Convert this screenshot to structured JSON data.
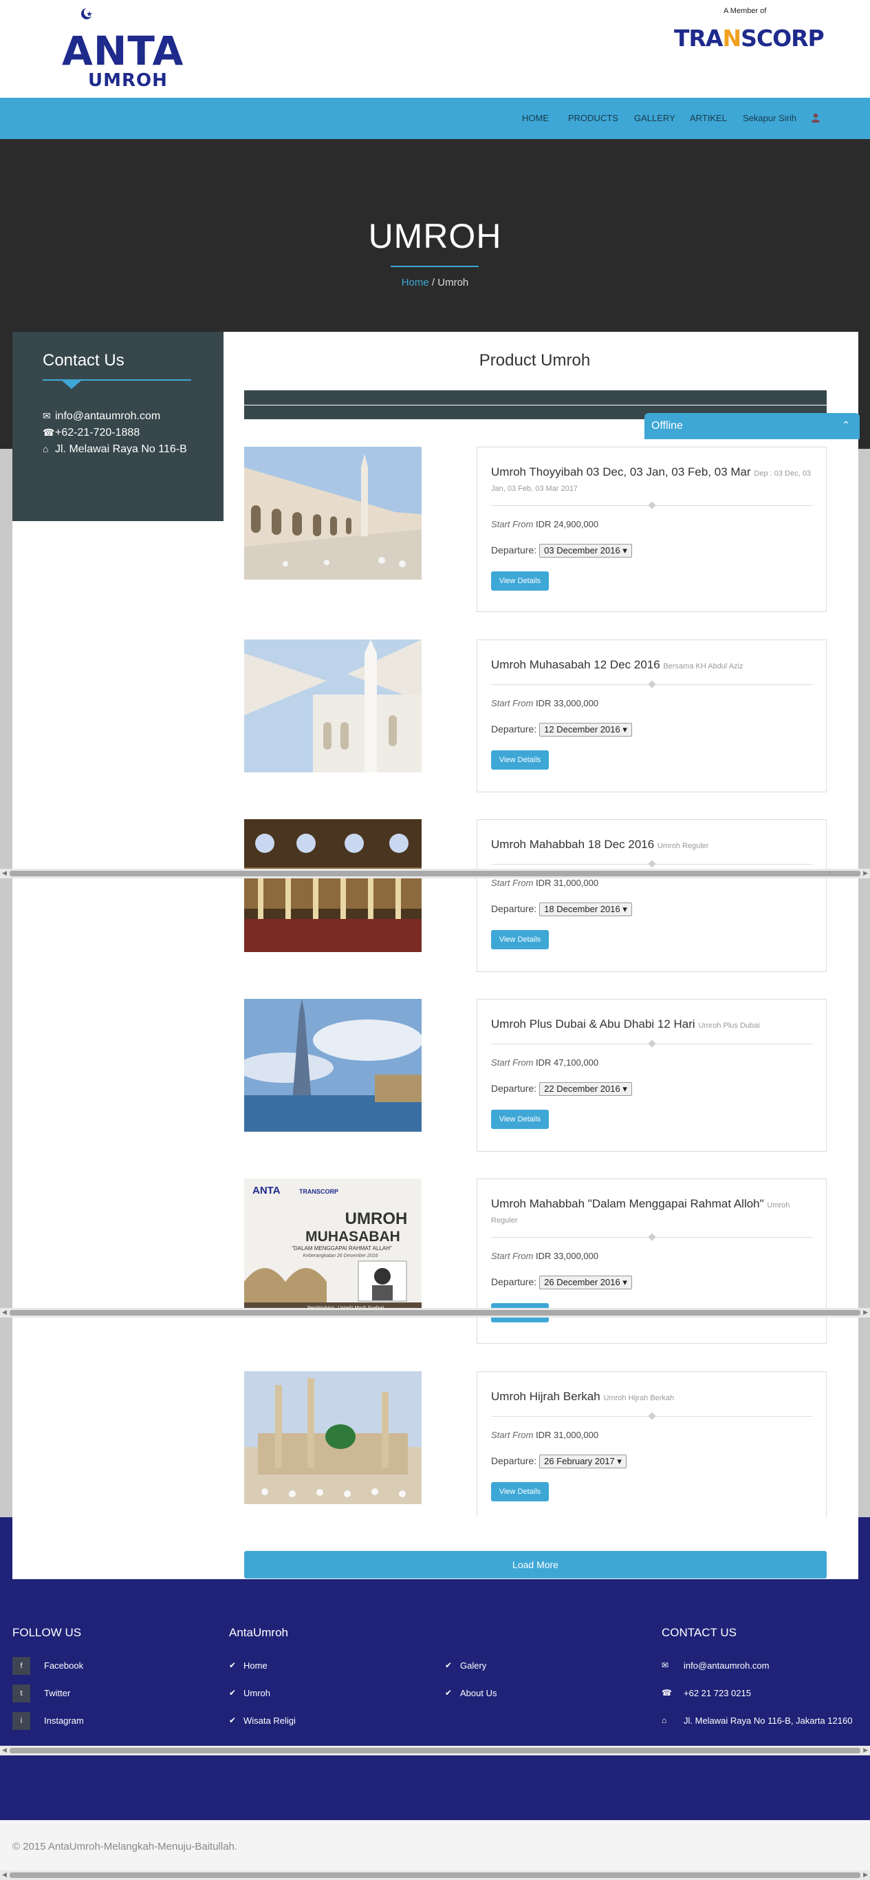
{
  "brand": {
    "logo_main": "ANTA",
    "logo_sub": "UMROH",
    "member_of": "A Member of",
    "partner_logo_1": "TRA",
    "partner_logo_2": "N",
    "partner_logo_3": "SCORP"
  },
  "nav": {
    "items": [
      "HOME",
      "PRODUCTS",
      "GALLERY",
      "ARTIKEL",
      "Sekapur Sirih"
    ],
    "user_icon": "user-icon"
  },
  "hero": {
    "title": "UMROH",
    "breadcrumb_home": "Home",
    "breadcrumb_sep": " / ",
    "breadcrumb_current": "Umroh"
  },
  "contact": {
    "title": "Contact Us",
    "email": "info@antaumroh.com",
    "phone": "+62-21-720-1888",
    "address": "Jl. Melawai Raya No 116-B"
  },
  "main": {
    "title": "Product Umroh"
  },
  "chat": {
    "status": "Offline"
  },
  "products": [
    {
      "name": "Umroh Thoyyibah 03 Dec, 03 Jan, 03 Feb, 03 Mar",
      "sub": "Dep : 03 Dec, 03 Jan, 03 Feb, 03 Mar 2017",
      "start_from_label": "Start From",
      "price": "IDR 24,900,000",
      "departure_label": "Departure:",
      "departure": "03 December 2016",
      "button": "View Details"
    },
    {
      "name": "Umroh Muhasabah 12 Dec 2016",
      "sub": "Bersama KH Abdul Aziz",
      "start_from_label": "Start From",
      "price": "IDR 33,000,000",
      "departure_label": "Departure:",
      "departure": "12 December 2016",
      "button": "View Details"
    },
    {
      "name": "Umroh Mahabbah 18 Dec 2016",
      "sub": "Umroh Reguler",
      "start_from_label": "Start From",
      "price": "IDR 31,000,000",
      "departure_label": "Departure:",
      "departure": "18 December 2016",
      "button": "View Details"
    },
    {
      "name": "Umroh Plus Dubai & Abu Dhabi 12 Hari",
      "sub": "Umroh Plus Dubai",
      "start_from_label": "Start From",
      "price": "IDR 47,100,000",
      "departure_label": "Departure:",
      "departure": "22 December 2016",
      "button": "View Details"
    },
    {
      "name": "Umroh Mahabbah \"Dalam Menggapai Rahmat Alloh\"",
      "sub": "Umroh Reguler",
      "start_from_label": "Start From",
      "price": "IDR 33,000,000",
      "departure_label": "Departure:",
      "departure": "26 December 2016",
      "button": "View Details"
    },
    {
      "name": "Umroh Hijrah Berkah",
      "sub": "Umroh Hijrah Berkah",
      "start_from_label": "Start From",
      "price": "IDR 31,000,000",
      "departure_label": "Departure:",
      "departure": "26 February 2017",
      "button": "View Details"
    }
  ],
  "poster": {
    "brand": "ANTA",
    "partner": "TRANSCORP",
    "title": "UMROH",
    "title2": "MUHASABAH",
    "tagline": "\"DALAM MENGGAPAI RAHMAT ALLAH\"",
    "date": "Keberangkatan 26 Desember 2016",
    "mentor": "Pembimbing : Ustadz Moch Syafaat"
  },
  "load_more": "Load More",
  "footer": {
    "follow_title": "FOLLOW US",
    "social": [
      {
        "icon": "f",
        "label": "Facebook"
      },
      {
        "icon": "t",
        "label": "Twitter"
      },
      {
        "icon": "i",
        "label": "Instagram"
      }
    ],
    "anta_title": "AntaUmroh",
    "links_col1": [
      "Home",
      "Umroh",
      "Wisata Religi"
    ],
    "links_col2": [
      "Galery",
      "About Us"
    ],
    "contact_title": "CONTACT US",
    "contact_email": "info@antaumroh.com",
    "contact_phone": "+62 21 723 0215",
    "contact_address": "Jl. Melawai Raya No 116-B, Jakarta 12160",
    "copyright": "© 2015 AntaUmroh-Melangkah-Menuju-Baitullah."
  },
  "colors": {
    "accent": "#3ea7d6",
    "dark": "#2b2b2b",
    "panel": "#37474b",
    "footer": "#1f2277"
  }
}
